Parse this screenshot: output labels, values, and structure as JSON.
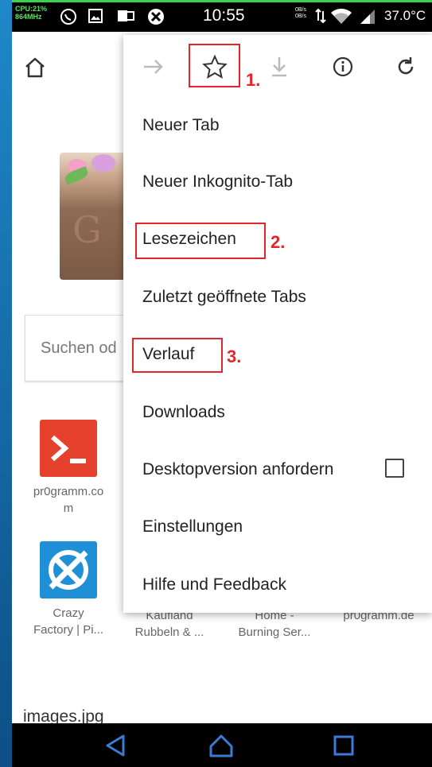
{
  "status_bar": {
    "cpu_line1": "CPU:21%",
    "cpu_line2": "864MHz",
    "time": "10:55",
    "net_line1": "0B/s",
    "net_line2": "0B/s",
    "temperature": "37.0°C"
  },
  "page": {
    "search_placeholder": "Suchen od",
    "tiles": [
      {
        "label1": "pr0gramm.co",
        "label2": "m",
        "icon": "terminal-icon",
        "color": "#e5412d"
      },
      {
        "label1": "Crazy",
        "label2": "Factory | Pi...",
        "icon": "crazy-factory-icon",
        "color": "#1f8fd6"
      },
      {
        "label1": "Kaufland",
        "label2": "Rubbeln & ..."
      },
      {
        "label1": "Home -",
        "label2": "Burning Ser..."
      },
      {
        "label1": "pr0gramm.de",
        "label2": ""
      }
    ],
    "download_item": "images.jpg"
  },
  "menu": {
    "toolbar": [
      "forward-icon",
      "star-icon",
      "download-icon",
      "info-icon",
      "reload-icon"
    ],
    "items": [
      {
        "label": "Neuer Tab"
      },
      {
        "label": "Neuer Inkognito-Tab"
      },
      {
        "label": "Lesezeichen"
      },
      {
        "label": "Zuletzt geöffnete Tabs"
      },
      {
        "label": "Verlauf"
      },
      {
        "label": "Downloads"
      },
      {
        "label": "Desktopversion anfordern",
        "checked": false
      },
      {
        "label": "Einstellungen"
      },
      {
        "label": "Hilfe und Feedback"
      }
    ]
  },
  "annotations": {
    "step1": "1.",
    "step2": "2.",
    "step3": "3.",
    "color": "#e3262b"
  }
}
